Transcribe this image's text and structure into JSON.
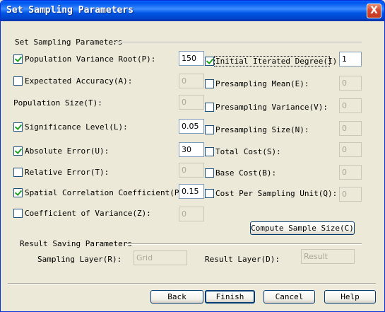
{
  "window": {
    "title": "Set Sampling Parameters",
    "close_label": "X"
  },
  "group1": {
    "title": "Set Sampling Parameters",
    "left": [
      {
        "label": "Population Variance Root(P):",
        "checked": true,
        "value": "150",
        "enabled": true
      },
      {
        "label": "Expectated Accuracy(A):",
        "checked": false,
        "value": "0",
        "enabled": false
      },
      {
        "label": "Population Size(T):",
        "checked": null,
        "value": "0",
        "enabled": false
      },
      {
        "label": "Significance Level(L):",
        "checked": true,
        "value": "0.05",
        "enabled": true
      },
      {
        "label": "Absolute Error(U):",
        "checked": true,
        "value": "30",
        "enabled": true
      },
      {
        "label": "Relative Error(T):",
        "checked": false,
        "value": "0",
        "enabled": false
      },
      {
        "label": "Spatial Correlation Coefficient(P):",
        "checked": true,
        "value": "0.15",
        "enabled": true
      },
      {
        "label": "Coefficient of Variance(Z):",
        "checked": false,
        "value": "0",
        "enabled": false
      }
    ],
    "right": [
      {
        "label": "Initial Iterated Degree(I)",
        "checked": true,
        "value": "1",
        "enabled": true
      },
      {
        "label": "Presampling Mean(E):",
        "checked": false,
        "value": "0",
        "enabled": false
      },
      {
        "label": "Presampling Variance(V):",
        "checked": false,
        "value": "0",
        "enabled": false
      },
      {
        "label": "Presampling Size(N):",
        "checked": false,
        "value": "0",
        "enabled": false
      },
      {
        "label": "Total Cost(S):",
        "checked": false,
        "value": "0",
        "enabled": false
      },
      {
        "label": "Base Cost(B):",
        "checked": false,
        "value": "0",
        "enabled": false
      },
      {
        "label": "Cost Per Sampling Unit(Q):",
        "checked": false,
        "value": "0",
        "enabled": false
      }
    ],
    "compute_button": "Compute Sample Size(C)"
  },
  "group2": {
    "title": "Result Saving Parameters",
    "sampling_layer_label": "Sampling Layer(R):",
    "sampling_layer_value": "Grid",
    "result_layer_label": "Result Layer(D):",
    "result_layer_value": "Result"
  },
  "buttons": {
    "back": "Back",
    "finish": "Finish",
    "cancel": "Cancel",
    "help": "Help"
  },
  "colors": {
    "title_bar": "#0055E5",
    "face": "#ECE9D8",
    "check": "#21A121"
  }
}
